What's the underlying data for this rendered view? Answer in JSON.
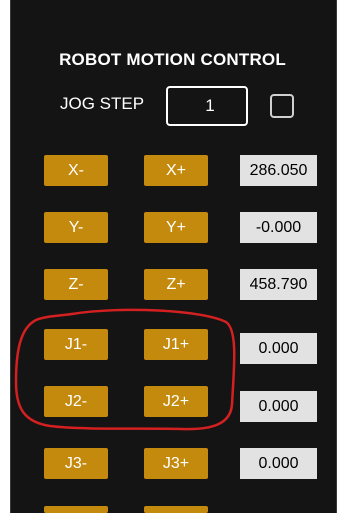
{
  "panel": {
    "title": "ROBOT MOTION CONTROL"
  },
  "jog": {
    "label": "JOG STEP",
    "value": "1",
    "checkbox_checked": false
  },
  "axes": [
    {
      "minus": "X-",
      "plus": "X+",
      "value": "286.050"
    },
    {
      "minus": "Y-",
      "plus": "Y+",
      "value": "-0.000"
    },
    {
      "minus": "Z-",
      "plus": "Z+",
      "value": "458.790"
    },
    {
      "minus": "J1-",
      "plus": "J1+",
      "value": "0.000"
    },
    {
      "minus": "J2-",
      "plus": "J2+",
      "value": "0.000"
    },
    {
      "minus": "J3-",
      "plus": "J3+",
      "value": "0.000"
    }
  ],
  "colors": {
    "panel_bg": "#141414",
    "button": "#c48a0e",
    "value_box": "#e2e2e2",
    "highlight_outline": "#d42020"
  }
}
